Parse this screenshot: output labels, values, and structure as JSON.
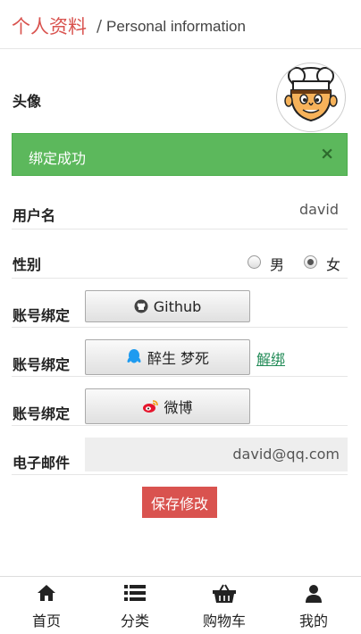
{
  "header": {
    "title_cn": "个人资料",
    "separator": "/",
    "title_en": "Personal information"
  },
  "avatar_label": "头像",
  "alert": {
    "message": "绑定成功",
    "close": "×"
  },
  "username": {
    "label": "用户名",
    "value": "david"
  },
  "gender": {
    "label": "性别",
    "options": [
      "男",
      "女"
    ],
    "selected": "女"
  },
  "bindings": [
    {
      "label": "账号绑定",
      "button": "Github",
      "icon": "github-icon"
    },
    {
      "label": "账号绑定",
      "button": "醉生 梦死",
      "icon": "qq-icon",
      "unbind": "解绑"
    },
    {
      "label": "账号绑定",
      "button": "微博",
      "icon": "weibo-icon"
    }
  ],
  "email": {
    "label": "电子邮件",
    "value": "david@qq.com"
  },
  "save_label": "保存修改",
  "nav": [
    {
      "label": "首页",
      "icon": "home-icon"
    },
    {
      "label": "分类",
      "icon": "list-icon"
    },
    {
      "label": "购物车",
      "icon": "basket-icon"
    },
    {
      "label": "我的",
      "icon": "user-icon"
    }
  ],
  "colors": {
    "accent": "#d9534f",
    "success": "#5cb85c",
    "link": "#228b57"
  }
}
